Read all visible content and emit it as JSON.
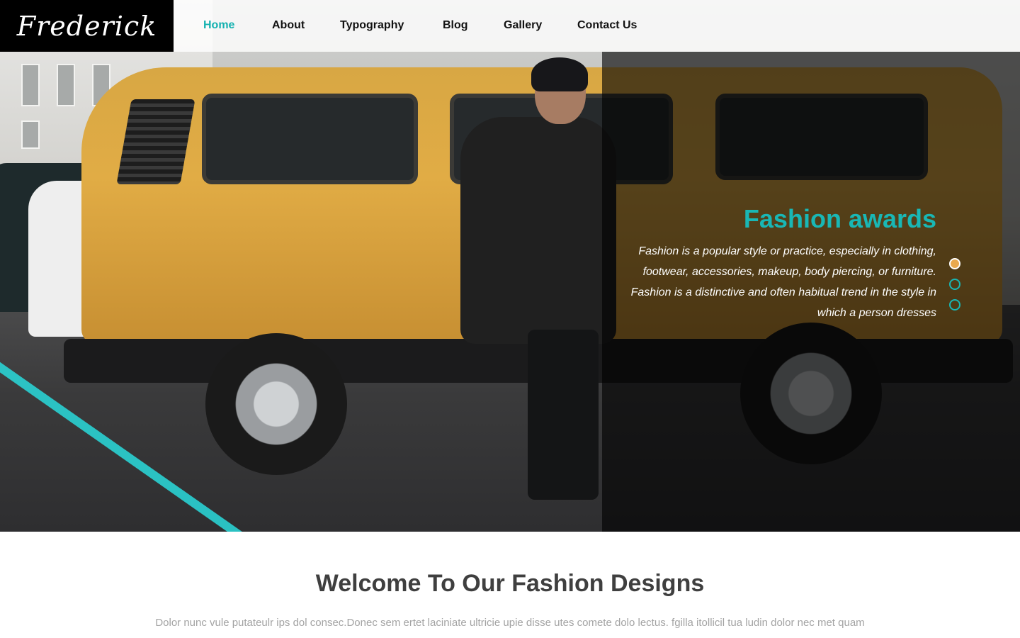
{
  "brand": {
    "logo_text": "Frederick"
  },
  "nav": {
    "items": [
      {
        "label": "Home",
        "active": true
      },
      {
        "label": "About",
        "active": false
      },
      {
        "label": "Typography",
        "active": false
      },
      {
        "label": "Blog",
        "active": false
      },
      {
        "label": "Gallery",
        "active": false
      },
      {
        "label": "Contact Us",
        "active": false
      }
    ]
  },
  "hero": {
    "slide_title": "Fashion awards",
    "slide_description": "Fashion is a popular style or practice, especially in clothing, footwear, accessories, makeup, body piercing, or furniture. Fashion is a distinctive and often habitual trend in the style in which a person dresses",
    "slider_dots": {
      "count": 3,
      "active_index": 0
    },
    "image_subject": "man-leaning-on-yellow-van"
  },
  "welcome": {
    "heading": "Welcome To Our Fashion Designs",
    "text": "Dolor nunc vule putateulr ips dol consec.Donec sem ertet laciniate ultricie upie disse utes comete dolo lectus. fgilla itollicil tua ludin dolor nec met quam"
  },
  "colors": {
    "accent": "#19b7b5",
    "active_nav": "#14b1b0",
    "active_dot": "#e9a94f",
    "logo_bg": "#000000",
    "heading": "#3f3f3f",
    "body_text": "#a3a3a3"
  }
}
